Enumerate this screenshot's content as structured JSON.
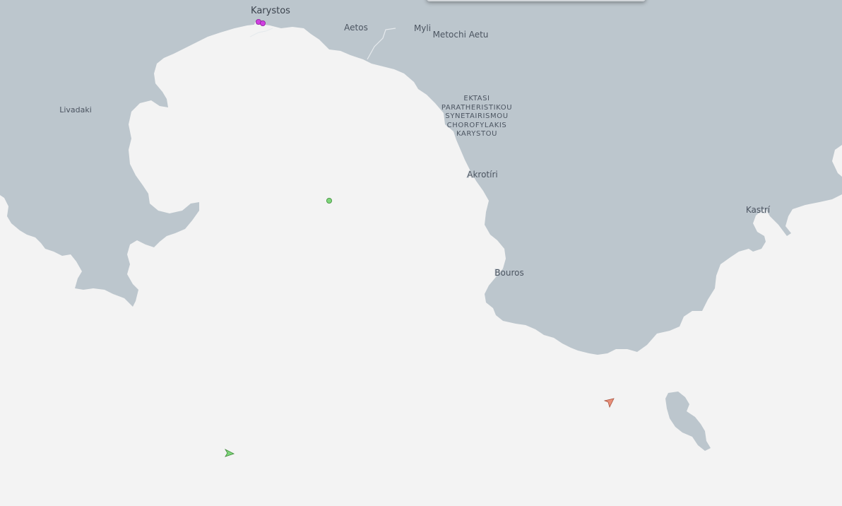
{
  "colors": {
    "land": "#bcc6cd",
    "sea": "#f3f3f3",
    "road": "#e6eaed",
    "vessel_green": "#7ed67a",
    "vessel_orange": "#e8907a",
    "vessel_magenta": "#d040e0"
  },
  "labels": {
    "karystos": "Karystos",
    "aetos": "Aetos",
    "myli": "Myli",
    "metochi": "Metochi Aetu",
    "livadaki": "Livadaki",
    "area_lines": [
      "EKTASI",
      "PARATHERISTIKOU",
      "SYNETAIRISMOU",
      "CHOROFYLAKIS",
      "KARYSTOU"
    ],
    "akrotiri": "Akrotíri",
    "kastri": "Kastrí",
    "bouros": "Bouros"
  },
  "vessels": [
    {
      "name": "vessel-magenta-1",
      "kind": "dot",
      "color": "magenta"
    },
    {
      "name": "vessel-magenta-2",
      "kind": "dot",
      "color": "magenta"
    },
    {
      "name": "vessel-green-dot",
      "kind": "dot",
      "color": "green"
    },
    {
      "name": "vessel-green-arrow",
      "kind": "arrow",
      "color": "green"
    },
    {
      "name": "vessel-orange-arrow",
      "kind": "arrow",
      "color": "orange"
    }
  ]
}
